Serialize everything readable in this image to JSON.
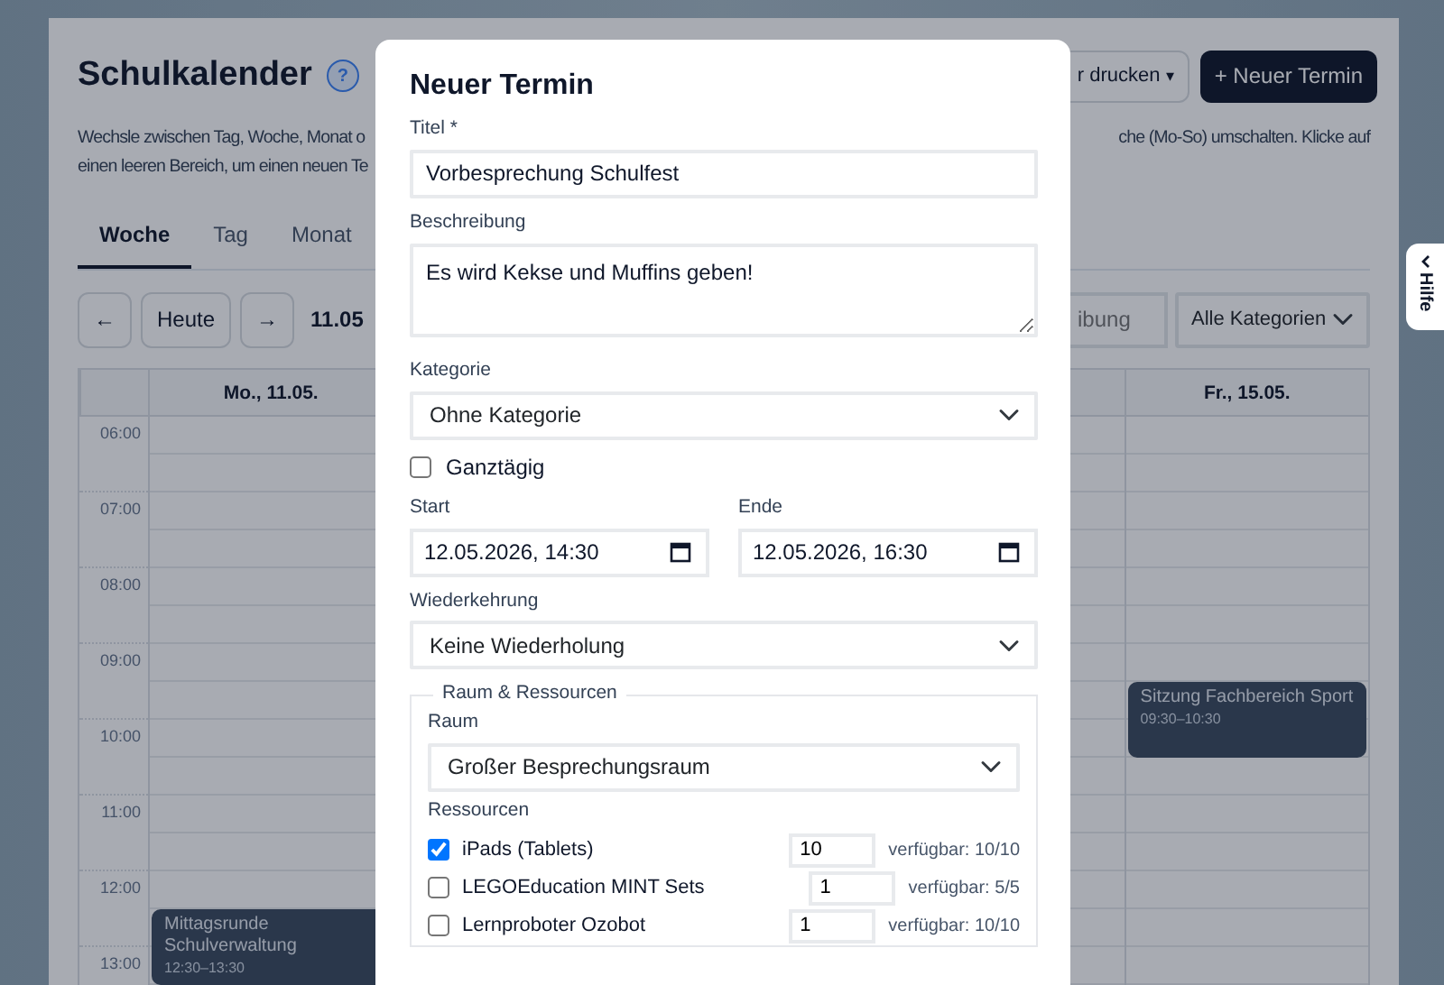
{
  "header": {
    "title": "Schulkalender",
    "help_icon": "?",
    "print_button": "r drucken",
    "print_caret": "▾",
    "new_button": "+ Neuer Termin"
  },
  "description": {
    "left_lines": [
      "Wechsle zwischen Tag, Woche, Monat o",
      "einen leeren Bereich, um einen neuen Te"
    ],
    "right_lines": [
      "che (Mo-So) umschalten. Klicke auf"
    ]
  },
  "tabs": [
    {
      "label": "Woche",
      "selected": true
    },
    {
      "label": "Tag",
      "selected": false
    },
    {
      "label": "Monat",
      "selected": false
    }
  ],
  "toolbar": {
    "prev": "←",
    "today": "Heute",
    "next": "→",
    "range": "11.05",
    "search": {
      "placeholder": "ibung"
    },
    "category_filter": "Alle Kategorien"
  },
  "calendar": {
    "hours": [
      "06:00",
      "07:00",
      "08:00",
      "09:00",
      "10:00",
      "11:00",
      "12:00",
      "13:00"
    ],
    "first_day": {
      "heading": "Mo., 11.05.",
      "events": [
        {
          "title": "Mittagsrunde Schulverwaltung",
          "time": "12:30–13:30"
        }
      ]
    },
    "last_day": {
      "heading": "Fr., 15.05.",
      "events": [
        {
          "title": "Sitzung Fachbereich Sport",
          "time": "09:30–10:30"
        }
      ]
    }
  },
  "modal": {
    "title": "Neuer Termin",
    "title_field": {
      "label": "Titel *",
      "value": "Vorbesprechung Schulfest"
    },
    "description_field": {
      "label": "Beschreibung",
      "value": "Es wird Kekse und Muffins geben!"
    },
    "category_field": {
      "label": "Kategorie",
      "value": "Ohne Kategorie"
    },
    "all_day": {
      "label": "Ganztägig",
      "checked": false
    },
    "start_field": {
      "label": "Start",
      "value": "12.05.2026, 14:30"
    },
    "end_field": {
      "label": "Ende",
      "value": "12.05.2026, 16:30"
    },
    "recurrence_field": {
      "label": "Wiederkehrung",
      "value": "Keine Wiederholung"
    },
    "resources_group": {
      "legend": "Raum & Ressourcen",
      "room_label": "Raum",
      "room_value": "Großer Besprechungsraum",
      "resources_label": "Ressourcen",
      "resources": [
        {
          "name": "iPads (Tablets)",
          "checked": true,
          "quantity": "10",
          "availability": "verfügbar: 10/10"
        },
        {
          "name": "LEGOEducation MINT Sets",
          "checked": false,
          "quantity": "1",
          "availability": "verfügbar: 5/5"
        },
        {
          "name": "Lernproboter Ozobot",
          "checked": false,
          "quantity": "1",
          "availability": "verfügbar: 10/10"
        }
      ]
    }
  },
  "help_tab": {
    "label": "Hilfe"
  }
}
